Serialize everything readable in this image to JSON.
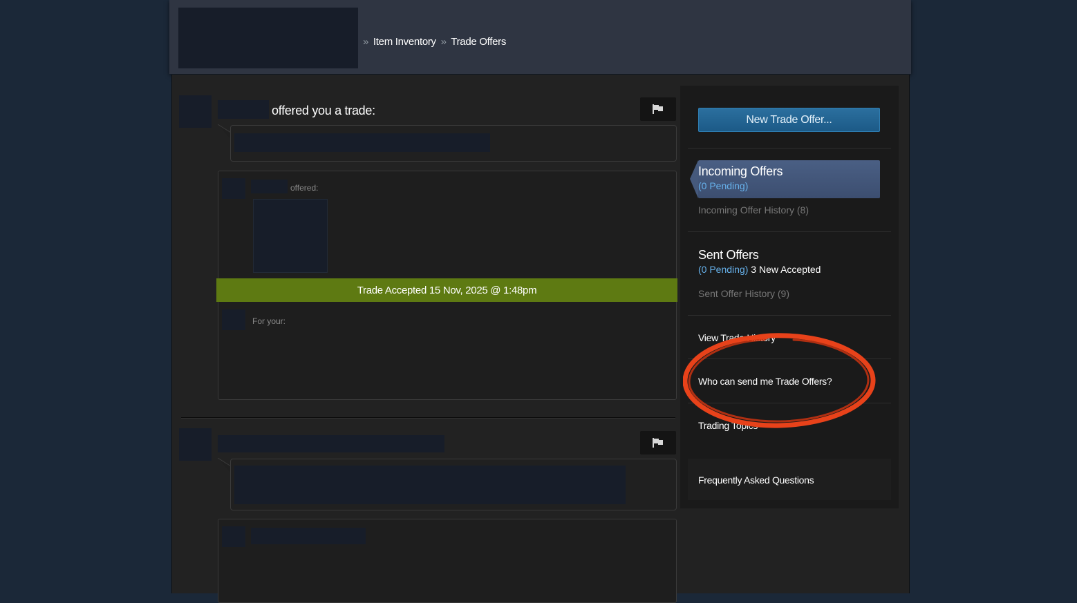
{
  "breadcrumb": {
    "separator": "»",
    "item_inventory": "Item Inventory",
    "trade_offers": "Trade Offers"
  },
  "offers": [
    {
      "heading_suffix": "offered you a trade:",
      "offered_label": "offered:",
      "status_banner": "Trade Accepted 15 Nov, 2025 @ 1:48pm",
      "for_your_label": "For your:"
    }
  ],
  "sidebar": {
    "new_offer_button": "New Trade Offer...",
    "incoming": {
      "title": "Incoming Offers",
      "pending": "(0 Pending)",
      "history": "Incoming Offer History (8)"
    },
    "sent": {
      "title": "Sent Offers",
      "pending": "(0 Pending)",
      "accepted": "3 New Accepted",
      "history": "Sent Offer History (9)"
    },
    "view_trade_history": "View Trade History",
    "who_can_send": "Who can send me Trade Offers?",
    "trading_topics": "Trading Topics",
    "faq": "Frequently Asked Questions"
  },
  "colors": {
    "page_bg": "#1b2838",
    "accepted_banner": "#5e7a12",
    "pending_blue": "#67b2ec",
    "annotation": "#e8421a"
  }
}
